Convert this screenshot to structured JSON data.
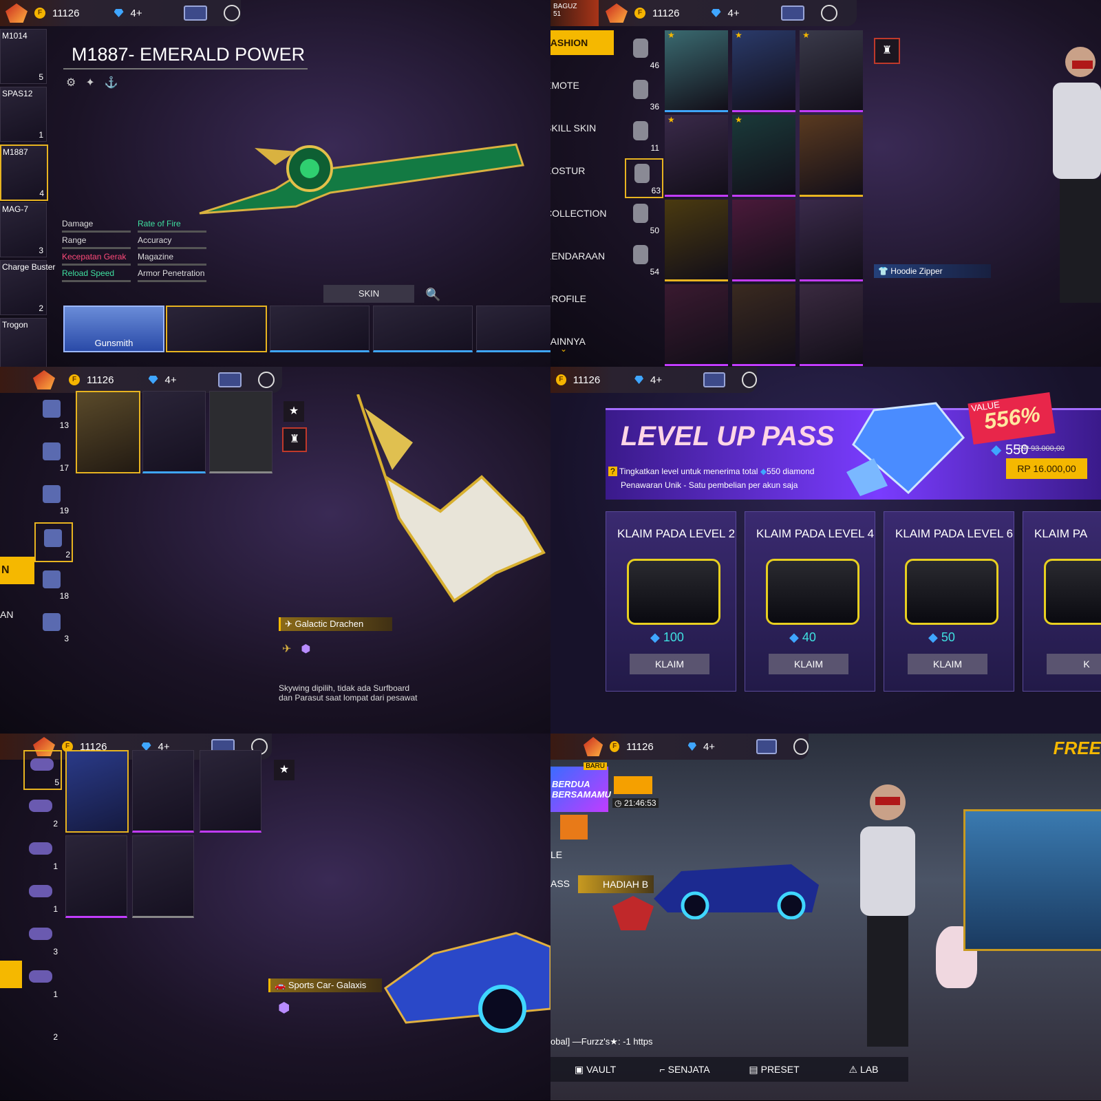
{
  "currency": {
    "coins": "11126",
    "diamonds": "4+"
  },
  "panel1": {
    "title": "M1887- EMERALD POWER",
    "left_items": [
      {
        "name": "M1014",
        "count": "5"
      },
      {
        "name": "SPAS12",
        "count": "1"
      },
      {
        "name": "M1887",
        "count": "4"
      },
      {
        "name": "MAG-7",
        "count": "3"
      },
      {
        "name": "Charge Buster",
        "count": "2"
      },
      {
        "name": "Trogon",
        "count": ""
      }
    ],
    "stats": [
      {
        "left": "Damage",
        "right": "Rate of Fire"
      },
      {
        "left": "Range",
        "right": "Accuracy"
      },
      {
        "left": "Kecepatan Gerak",
        "right": "Magazine"
      },
      {
        "left": "Reload Speed",
        "right": "Armor Penetration"
      }
    ],
    "skin_button": "SKIN",
    "bottom_first_label": "Gunsmith"
  },
  "panel2": {
    "profile_name": "BAGUZ",
    "level": "51",
    "categories": [
      "FASHION",
      "EMOTE",
      "SKILL SKIN",
      "KOSTUR",
      "COLLECTION",
      "KENDARAAN",
      "PROFILE",
      "LAINNYA"
    ],
    "sub_counts": [
      "46",
      "36",
      "11",
      "63",
      "50",
      "54"
    ],
    "item_label": "Hoodie Zipper"
  },
  "panel3": {
    "sub_counts": [
      "13",
      "17",
      "19",
      "2",
      "18",
      "3"
    ],
    "item_name": "Galactic Drachen",
    "description": "Skywing dipilih, tidak ada Surfboard dan Parasut saat lompat dari pesawat"
  },
  "panel4": {
    "title": "LEVEL UP PASS",
    "value_label": "VALUE",
    "value_percent": "556%",
    "bonus_diamonds": "550",
    "old_price": "RP 93.000,00",
    "price": "RP 16.000,00",
    "line1": "Tingkatkan level untuk menerima total",
    "line1_amount": "550 diamond",
    "line2": "Penawaran Unik - Satu pembelian per akun saja",
    "cards": [
      {
        "title": "KLAIM PADA LEVEL 2",
        "amount": "100",
        "button": "KLAIM"
      },
      {
        "title": "KLAIM PADA LEVEL 4",
        "amount": "40",
        "button": "KLAIM"
      },
      {
        "title": "KLAIM PADA LEVEL 6",
        "amount": "50",
        "button": "KLAIM"
      },
      {
        "title": "KLAIM PA",
        "amount": "",
        "button": "K"
      }
    ]
  },
  "panel5": {
    "sub_counts": [
      "5",
      "2",
      "1",
      "1",
      "3",
      "1",
      "2"
    ],
    "item_name": "Sports Car- Galaxis"
  },
  "panel6": {
    "badge_new": "BARU",
    "event_text": "BERDUA BERSAMAMU",
    "timer": "21:46:53",
    "side_labels": [
      "LE",
      "ASS"
    ],
    "gift_label": "HADIAH B",
    "brand_corner": "FREE",
    "chat": "obal] —Furzz's★: -1 https",
    "nav": [
      "VAULT",
      "SENJATA",
      "PRESET",
      "LAB"
    ]
  },
  "colors": {
    "accent": "#f5b800",
    "diamond": "#3fa6ff",
    "purple": "#7a3cff",
    "pink": "#ff3c7a"
  }
}
